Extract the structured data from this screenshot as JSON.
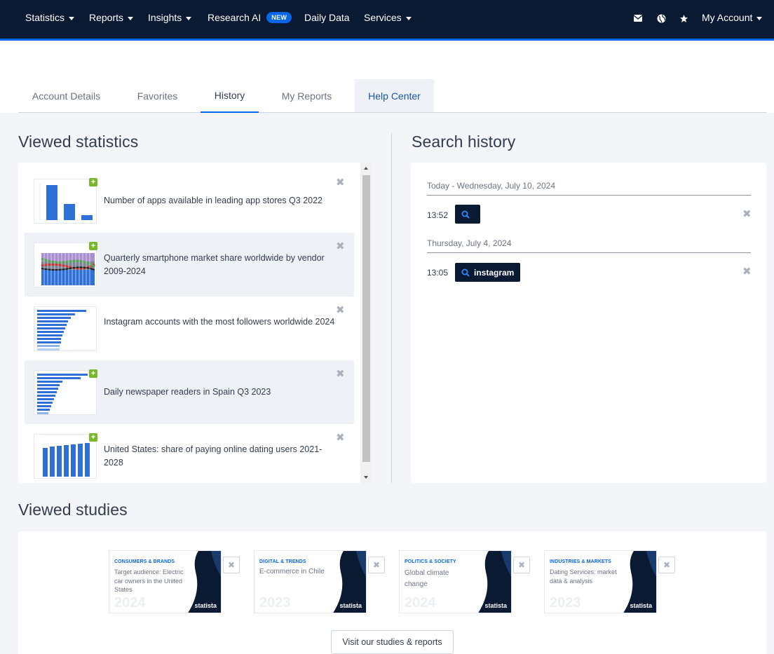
{
  "nav": {
    "items": [
      {
        "label": "Statistics",
        "caret": true
      },
      {
        "label": "Reports",
        "caret": true
      },
      {
        "label": "Insights",
        "caret": true
      },
      {
        "label": "Research AI",
        "badge": "NEW"
      },
      {
        "label": "Daily Data"
      },
      {
        "label": "Services",
        "caret": true
      }
    ],
    "icons": [
      "mail-icon",
      "globe-icon",
      "star-icon"
    ],
    "account_label": "My Account"
  },
  "tabs": [
    {
      "label": "Account Details"
    },
    {
      "label": "Favorites"
    },
    {
      "label": "History",
      "active": true
    },
    {
      "label": "My Reports"
    },
    {
      "label": "Help Center"
    }
  ],
  "viewed_statistics": {
    "title": "Viewed statistics",
    "items": [
      {
        "title": "Number of apps available in leading app stores Q3 2022",
        "thumb": "bar-chart"
      },
      {
        "title": "Quarterly smartphone market share worldwide by vendor 2009-2024",
        "thumb": "stacked-bar"
      },
      {
        "title": "Instagram accounts with the most followers worldwide 2024",
        "thumb": "horizontal-bar"
      },
      {
        "title": "Daily newspaper readers in Spain Q3 2023",
        "thumb": "horizontal-bar"
      },
      {
        "title": "United States: share of paying online dating users 2021-2028",
        "thumb": "bar-chart"
      }
    ]
  },
  "search_history": {
    "title": "Search history",
    "groups": [
      {
        "date": "Today - Wednesday, July 10, 2024",
        "entries": [
          {
            "time": "13:52",
            "query": ""
          }
        ]
      },
      {
        "date": "Thursday, July 4, 2024",
        "entries": [
          {
            "time": "13:05",
            "query": "instagram"
          }
        ]
      }
    ]
  },
  "viewed_studies": {
    "title": "Viewed studies",
    "items": [
      {
        "category": "CONSUMERS & BRANDS",
        "text": "Target audience: Electric car owners in the United States",
        "year": "2024",
        "brand": "statista"
      },
      {
        "category": "DIGITAL & TRENDS",
        "text": "E-commerce in Chile",
        "year": "2023",
        "brand": "statista"
      },
      {
        "category": "POLITICS & SOCIETY",
        "text": "Global climate change",
        "year": "2024",
        "brand": "statista"
      },
      {
        "category": "INDUSTRIES & MARKETS",
        "text": "Dating Services: market data & analysis",
        "year": "2023",
        "brand": "statista"
      }
    ],
    "button_label": "Visit our studies & reports"
  },
  "colors": {
    "nav_bg": "#0b1a33",
    "accent": "#0666e5",
    "plus_green": "#78b72a"
  }
}
